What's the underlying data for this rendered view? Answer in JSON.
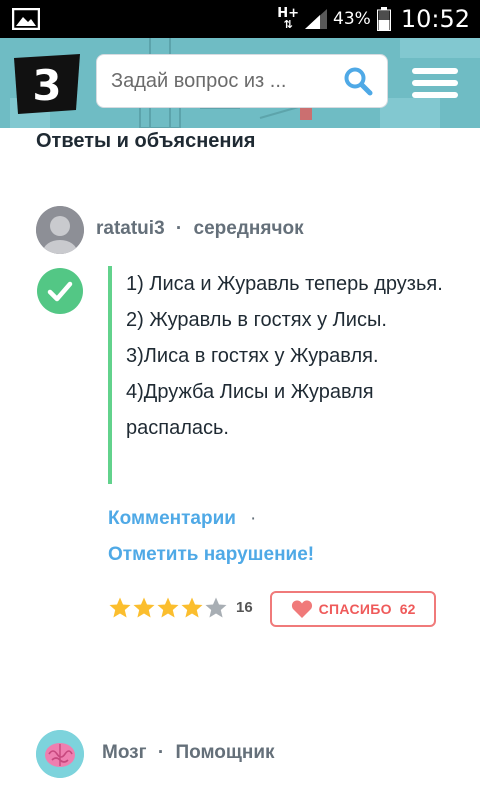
{
  "status_bar": {
    "network": "H+",
    "battery_percent": "43%",
    "time": "10:52"
  },
  "header": {
    "logo_text": "3",
    "search_placeholder": "Задай вопрос из ...",
    "colors": {
      "background": "#6fbcc4",
      "logo": "#111111",
      "search_icon": "#4fa9e6"
    }
  },
  "answers": {
    "title": "Ответы и объяснения",
    "items": [
      {
        "author": "ratatui3",
        "separator": "·",
        "rank": "середнячок",
        "lines": [
          "1) Лиса и Журавль теперь друзья.",
          "2) Журавль в гостях у Лисы.",
          "3)Лиса в гостях у Журавля.",
          "4)Дружба Лисы и Журавля распалась."
        ],
        "links": {
          "comments": "Комментарии",
          "dot": "·",
          "report": "Отметить нарушение!"
        },
        "rating": {
          "stars": 4,
          "max": 5,
          "count": "16"
        },
        "thanks": {
          "label": "СПАСИБО",
          "count": "62"
        },
        "best_answer_icon": "check-icon"
      }
    ]
  },
  "next_author": {
    "name": "Мозг",
    "separator": "·",
    "rank": "Помощник",
    "avatar_icon": "brain-icon"
  }
}
